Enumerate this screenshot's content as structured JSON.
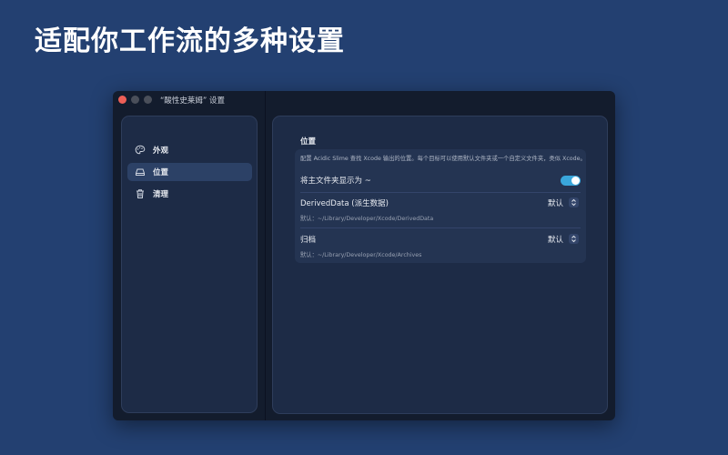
{
  "headline": "适配你工作流的多种设置",
  "window": {
    "title": "“酸性史莱姆” 设置"
  },
  "sidebar": {
    "items": [
      {
        "label": "外观",
        "icon": "palette-icon",
        "selected": false
      },
      {
        "label": "位置",
        "icon": "drive-icon",
        "selected": true
      },
      {
        "label": "清理",
        "icon": "trash-icon",
        "selected": false
      }
    ]
  },
  "content": {
    "section_title": "位置",
    "description": "配置 Acidic Slime 查找 Xcode 输出的位置。每个目标可以使用默认文件夹或一个自定义文件夹，类似 Xcode。",
    "rows": [
      {
        "label": "将主文件夹显示为 ~",
        "control": "toggle",
        "value": true
      },
      {
        "label": "DerivedData (派生数据)",
        "control": "select",
        "value": "默认",
        "default_path": "默认：~/Library/Developer/Xcode/DerivedData"
      },
      {
        "label": "归档",
        "control": "select",
        "value": "默认",
        "default_path": "默认：~/Library/Developer/Xcode/Archives"
      }
    ]
  },
  "colors": {
    "background": "#234071",
    "window": "#131c2d",
    "panel": "#1d2b46",
    "selection": "#2c4166",
    "toggle_on": "#3aa7dc",
    "close_button": "#ed5f57"
  }
}
